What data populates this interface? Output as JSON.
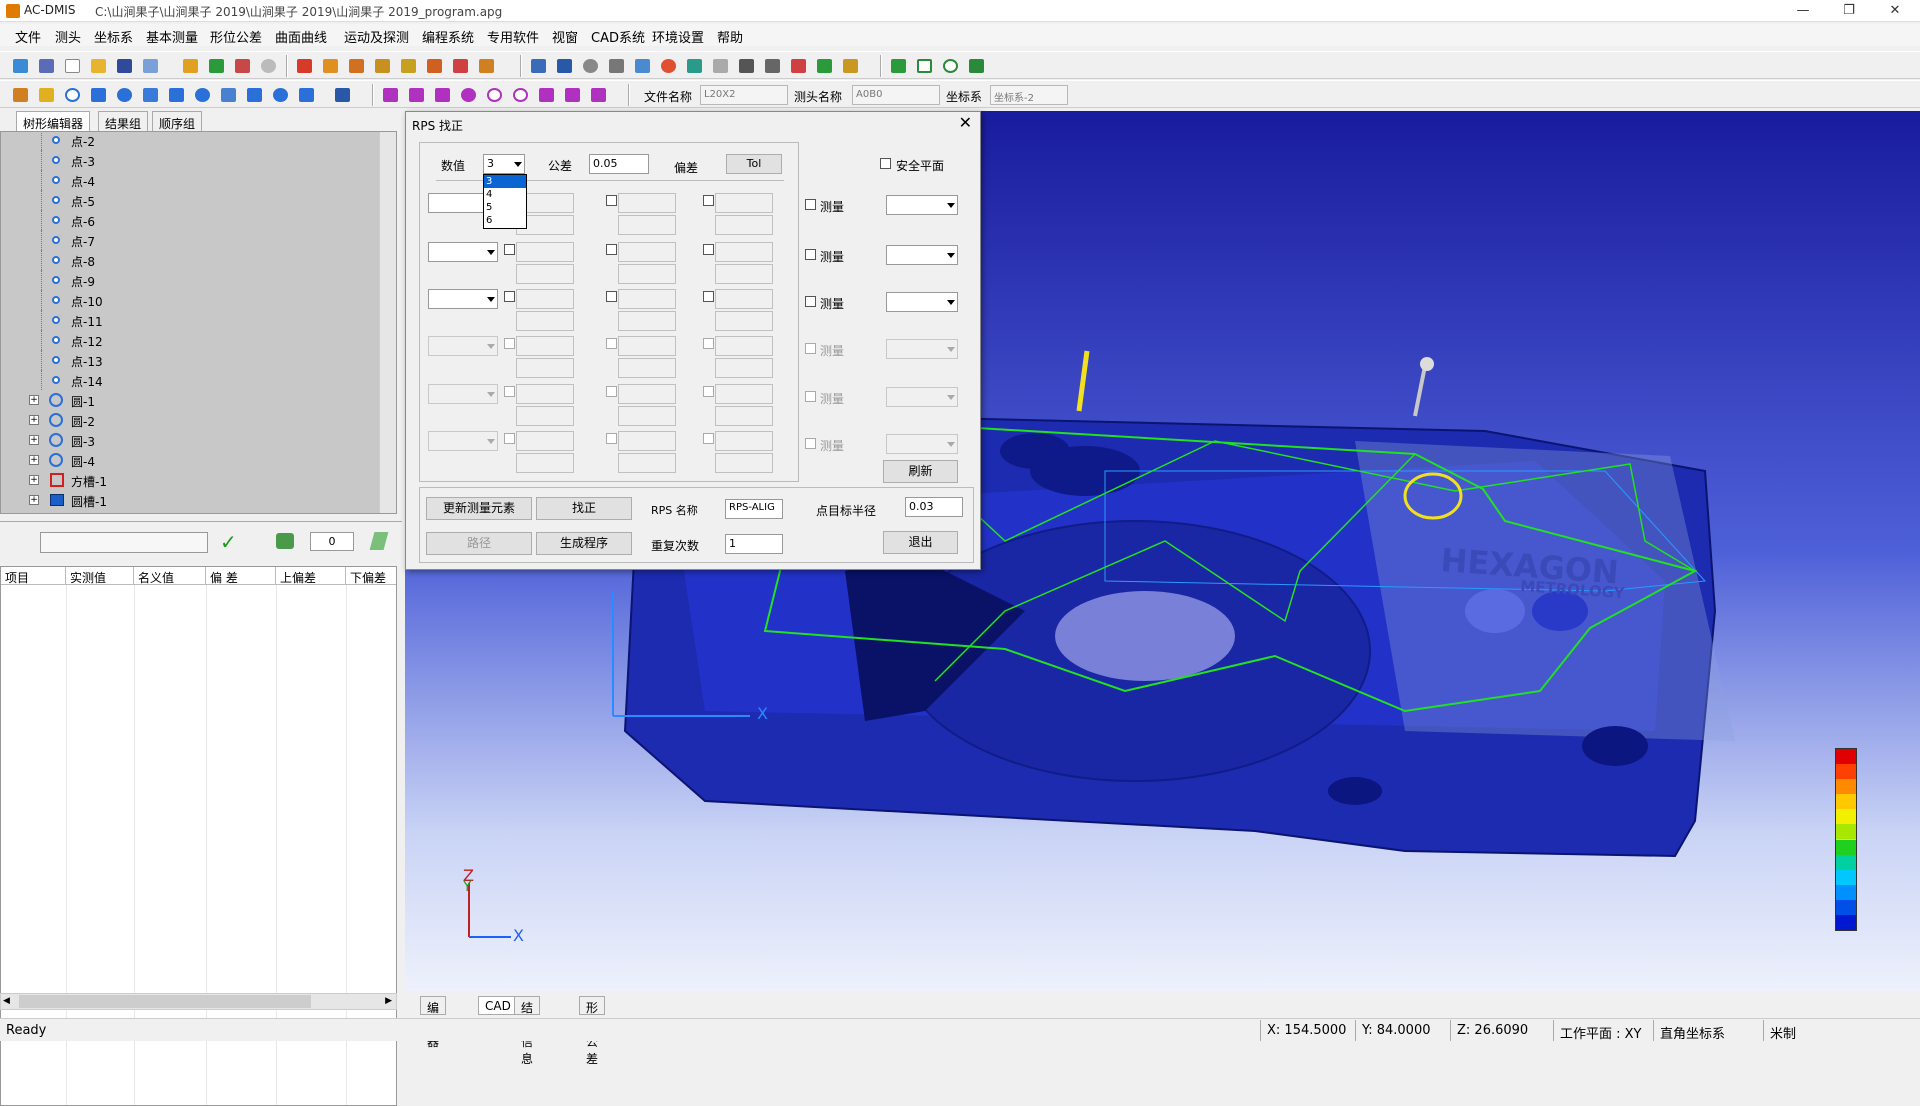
{
  "window": {
    "app_title": "AC-DMIS",
    "file_path": "C:\\山涧果子\\山涧果子 2019\\山涧果子 2019\\山涧果子 2019_program.apg",
    "minimize": "—",
    "restore": "❐",
    "close": "✕"
  },
  "menu": [
    "文件",
    "测头",
    "坐标系",
    "基本测量",
    "形位公差",
    "曲面曲线",
    "运动及探测",
    "编程系统",
    "专用软件",
    "视窗",
    "CAD系统",
    "环境设置",
    "帮助"
  ],
  "toolbar2": {
    "file_label": "文件名称",
    "file_value": "L20X2",
    "probe_label": "测头名称",
    "probe_value": "A0B0",
    "coord_label": "坐标系",
    "coord_value": "坐标系-2"
  },
  "left_tabs": [
    "树形编辑器",
    "结果组",
    "顺序组"
  ],
  "tree": {
    "points": [
      "点-2",
      "点-3",
      "点-4",
      "点-5",
      "点-6",
      "点-7",
      "点-8",
      "点-9",
      "点-10",
      "点-11",
      "点-12",
      "点-13",
      "点-14"
    ],
    "circles": [
      "圆-1",
      "圆-2",
      "圆-3",
      "圆-4"
    ],
    "square_slot": "方槽-1",
    "round_slot": "圆槽-1"
  },
  "meas_bar": {
    "count": "0"
  },
  "result_table": {
    "headers": [
      "项目",
      "实测值",
      "名义值",
      "偏 差",
      "上偏差",
      "下偏差"
    ]
  },
  "bottom_tabs": [
    "编辑器",
    "CAD",
    "结果信息",
    "形状公差"
  ],
  "status": {
    "ready": "Ready",
    "x": "X: 154.5000",
    "y": "Y: 84.0000",
    "z": "Z: 26.6090",
    "plane": "工作平面 : XY",
    "coord": "直角坐标系",
    "unit": "米制"
  },
  "viewport": {
    "logo_main": "HEXAGON",
    "logo_sub": "METROLOGY",
    "axis_x": "X",
    "axis_z": "Z",
    "axis_y": "Y",
    "axis_x2": "X"
  },
  "dialog": {
    "title": "RPS 找正",
    "close": "✕",
    "value_label": "数值",
    "value_selected": "3",
    "value_options": [
      "3",
      "4",
      "5",
      "6"
    ],
    "tolerance_label": "公差",
    "tolerance_value": "0.05",
    "deviation_label": "偏差",
    "tol_button": "Tol",
    "safe_plane_label": "安全平面",
    "measure_label": "测量",
    "refresh_button": "刷新",
    "update_button": "更新测量元素",
    "align_button": "找正",
    "path_button": "路径",
    "gen_button": "生成程序",
    "rps_name_label": "RPS 名称",
    "rps_name_value": "RPS-ALIG",
    "repeat_label": "重复次数",
    "repeat_value": "1",
    "target_radius_label": "点目标半径",
    "target_radius_value": "0.03",
    "exit_button": "退出"
  },
  "colors": {
    "scale": [
      "#e00000",
      "#ff4000",
      "#ff8a00",
      "#ffc800",
      "#f0f000",
      "#a8e800",
      "#20d020",
      "#00d0a0",
      "#00c8ff",
      "#0090ff",
      "#0050e8",
      "#0018d0"
    ]
  }
}
